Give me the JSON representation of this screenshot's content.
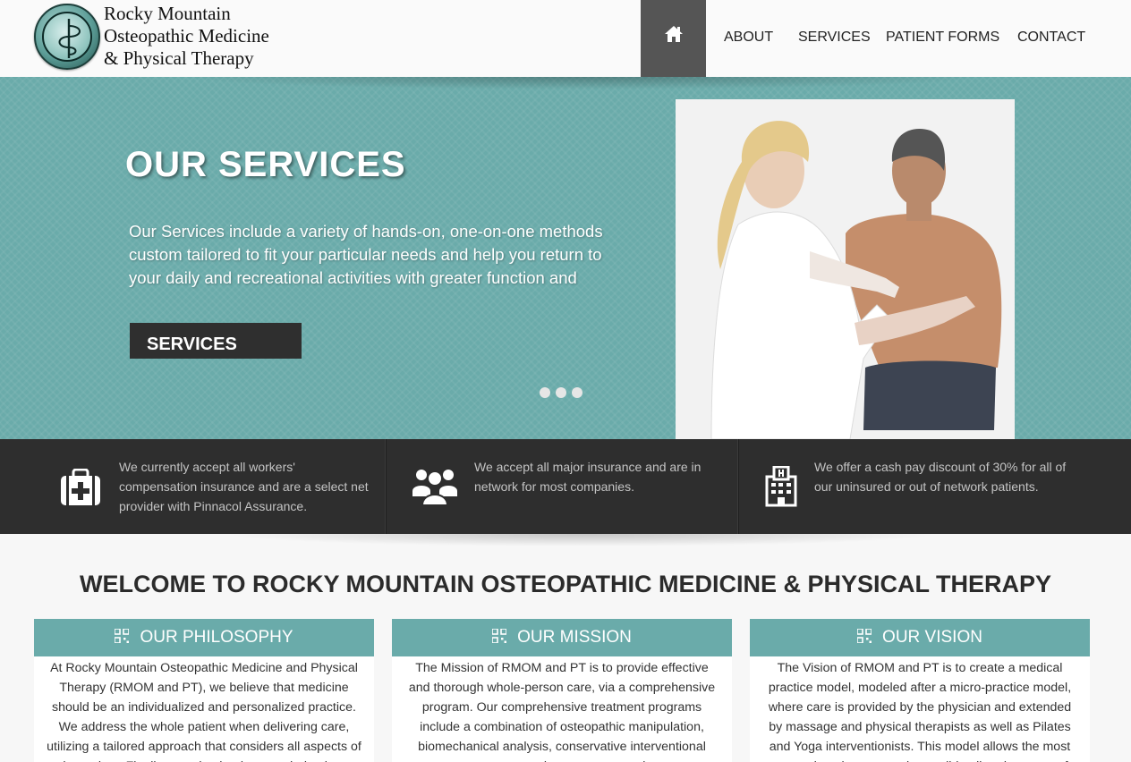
{
  "brand": {
    "line1": "Rocky Mountain",
    "line2": "Osteopathic Medicine",
    "line3": "& Physical Therapy"
  },
  "nav": {
    "home_icon": "home-icon",
    "items": [
      "ABOUT",
      "SERVICES",
      "PATIENT FORMS",
      "CONTACT"
    ]
  },
  "hero": {
    "title": "OUR SERVICES",
    "text": "Our Services include a variety of hands-on, one-on-one methods custom tailored to fit your particular needs and help you return to your daily and recreational activities with greater function and",
    "button": "SERVICES",
    "slide_count": 3
  },
  "info": [
    {
      "icon": "medical-kit-icon",
      "text": "We currently accept all workers' compensation insurance and are a select net provider with Pinnacol Assurance."
    },
    {
      "icon": "users-icon",
      "text": "We accept all major insurance and are in network for most companies."
    },
    {
      "icon": "hospital-icon",
      "text": "We offer a cash pay discount of 30% for all of our uninsured or out of network patients."
    }
  ],
  "welcome": "WELCOME TO ROCKY MOUNTAIN OSTEOPATHIC MEDICINE & PHYSICAL THERAPY",
  "columns": [
    {
      "icon": "qr-code-icon",
      "title": "OUR PHILOSOPHY",
      "text": "At Rocky Mountain Osteopathic Medicine and Physical Therapy (RMOM and PT), we believe that medicine should be an individualized and personalized practice. We address the whole patient when delivering care, utilizing a tailored approach that considers all aspects of the patient. Finally, we take the time needed to best"
    },
    {
      "icon": "qr-code-icon",
      "title": "OUR MISSION",
      "text": "The Mission of RMOM and PT is to provide effective and thorough whole-person care, via a comprehensive program. Our comprehensive treatment programs include a combination of osteopathic manipulation, biomechanical analysis, conservative interventional treatments, exercise programs, and more"
    },
    {
      "icon": "qr-code-icon",
      "title": "OUR VISION",
      "text": "The Vision of RMOM and PT is to create a medical practice model, modeled after a micro-practice model, where care is provided by the physician and extended by massage and physical therapists as well as Pilates and Yoga interventionists. This model allows the most comprehensive care as is possible all under one roof"
    }
  ],
  "colors": {
    "teal": "#6aabaa",
    "dark": "#2e2e2e",
    "nav_active": "#555555"
  }
}
